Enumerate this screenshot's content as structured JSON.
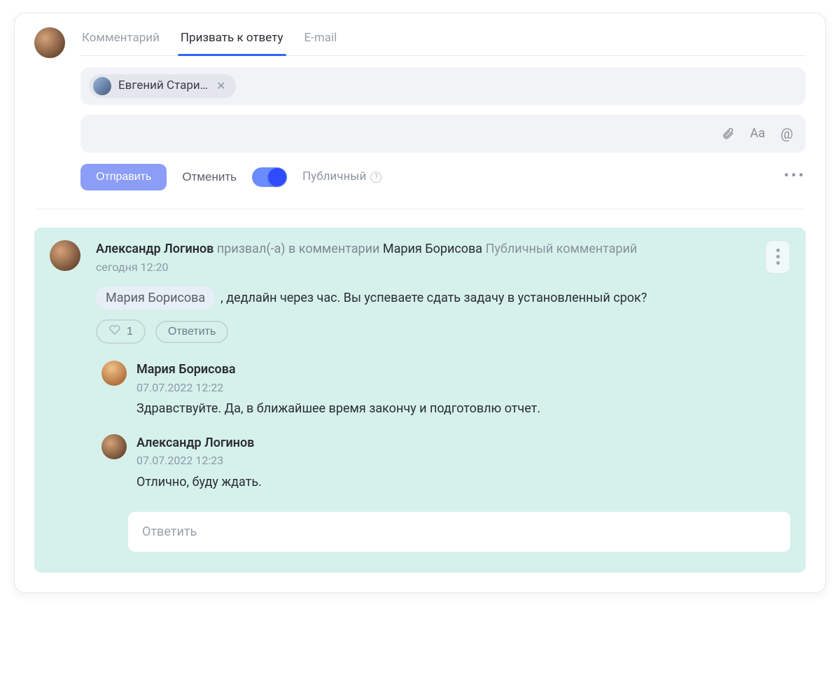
{
  "composer": {
    "tabs": [
      {
        "label": "Комментарий",
        "active": false
      },
      {
        "label": "Призвать к ответу",
        "active": true
      },
      {
        "label": "E-mail",
        "active": false
      }
    ],
    "chip": {
      "name": "Евгений Стари…"
    },
    "text_aa": "Aa",
    "text_at": "@",
    "submit": "Отправить",
    "cancel": "Отменить",
    "visibility_label": "Публичный",
    "more": "•••"
  },
  "comment": {
    "author": "Александр Логинов",
    "verb": "призвал(-а) в комментарии",
    "target": "Мария Борисова",
    "visibility": "Публичный комментарий",
    "time": "сегодня 12:20",
    "mention": "Мария Борисова",
    "text": ", дедлайн через час. Вы успеваете сдать задачу в установленный срок?",
    "like_count": "1",
    "reply_label": "Ответить",
    "replies": [
      {
        "author": "Мария Борисова",
        "time": "07.07.2022 12:22",
        "text": "Здравствуйте. Да, в ближайшее время закончу и подготовлю отчет."
      },
      {
        "author": "Александр Логинов",
        "time": "07.07.2022 12:23",
        "text": "Отлично, буду ждать."
      }
    ],
    "reply_placeholder": "Ответить"
  }
}
